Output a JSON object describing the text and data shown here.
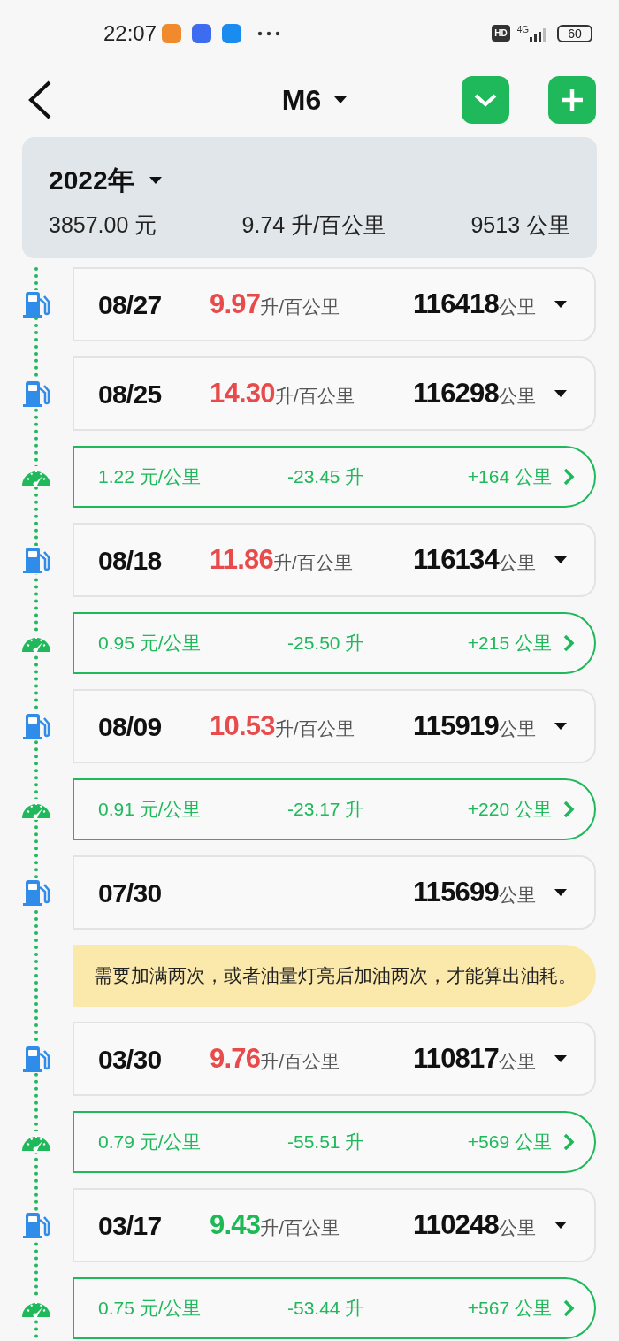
{
  "status_bar": {
    "time": "22:07",
    "battery": "60",
    "network": "4G",
    "hd": "HD"
  },
  "header": {
    "title": "M6"
  },
  "summary": {
    "year": "2022年",
    "cost": "3857.00 元",
    "consumption": "9.74 升/百公里",
    "distance": "9513 公里"
  },
  "items": [
    {
      "kind": "refuel",
      "date": "08/27",
      "consumption": "9.97",
      "consumption_unit": "升/百公里",
      "color": "#e84b4b",
      "odometer": "116418",
      "odometer_unit": "公里"
    },
    {
      "kind": "refuel",
      "date": "08/25",
      "consumption": "14.30",
      "consumption_unit": "升/百公里",
      "color": "#e84b4b",
      "odometer": "116298",
      "odometer_unit": "公里"
    },
    {
      "kind": "trip",
      "cost_per_km": "1.22 元/公里",
      "fuel": "-23.45 升",
      "distance": "+164 公里"
    },
    {
      "kind": "refuel",
      "date": "08/18",
      "consumption": "11.86",
      "consumption_unit": "升/百公里",
      "color": "#e84b4b",
      "odometer": "116134",
      "odometer_unit": "公里"
    },
    {
      "kind": "trip",
      "cost_per_km": "0.95 元/公里",
      "fuel": "-25.50 升",
      "distance": "+215 公里"
    },
    {
      "kind": "refuel",
      "date": "08/09",
      "consumption": "10.53",
      "consumption_unit": "升/百公里",
      "color": "#e84b4b",
      "odometer": "115919",
      "odometer_unit": "公里"
    },
    {
      "kind": "trip",
      "cost_per_km": "0.91 元/公里",
      "fuel": "-23.17 升",
      "distance": "+220 公里"
    },
    {
      "kind": "refuel",
      "date": "07/30",
      "odometer": "115699",
      "odometer_unit": "公里"
    },
    {
      "kind": "notice",
      "text": "需要加满两次，或者油量灯亮后加油两次，才能算出油耗。"
    },
    {
      "kind": "refuel",
      "date": "03/30",
      "consumption": "9.76",
      "consumption_unit": "升/百公里",
      "color": "#e84b4b",
      "odometer": "110817",
      "odometer_unit": "公里"
    },
    {
      "kind": "trip",
      "cost_per_km": "0.79 元/公里",
      "fuel": "-55.51 升",
      "distance": "+569 公里"
    },
    {
      "kind": "refuel",
      "date": "03/17",
      "consumption": "9.43",
      "consumption_unit": "升/百公里",
      "color": "#1db954",
      "odometer": "110248",
      "odometer_unit": "公里"
    },
    {
      "kind": "trip",
      "cost_per_km": "0.75 元/公里",
      "fuel": "-53.44 升",
      "distance": "+567 公里"
    }
  ]
}
